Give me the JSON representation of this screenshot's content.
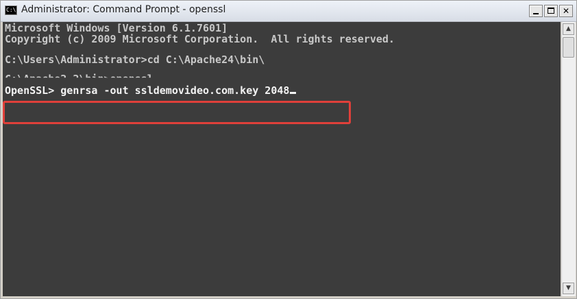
{
  "window": {
    "title": "Administrator: Command Prompt - openssl",
    "icon_label": "C:\\.",
    "controls": {
      "minimize_icon": "minimize-icon",
      "maximize_icon": "maximize-icon",
      "close_glyph": "✕"
    }
  },
  "console": {
    "lines": [
      "Microsoft Windows [Version 6.1.7601]",
      "Copyright (c) 2009 Microsoft Corporation.  All rights reserved.",
      "C:\\Users\\Administrator>cd C:\\Apache24\\bin\\",
      "C:\\Apache2.2\\bin>openssl",
      "OpenSSL> genrsa -out ssldemovideo.com.key 2048"
    ],
    "text_color": "#c8c8c8",
    "background_color": "#3c3c3c"
  },
  "highlight": {
    "color": "#e0403a"
  },
  "scrollbar": {
    "up_glyph": "▲",
    "down_glyph": "▼"
  }
}
